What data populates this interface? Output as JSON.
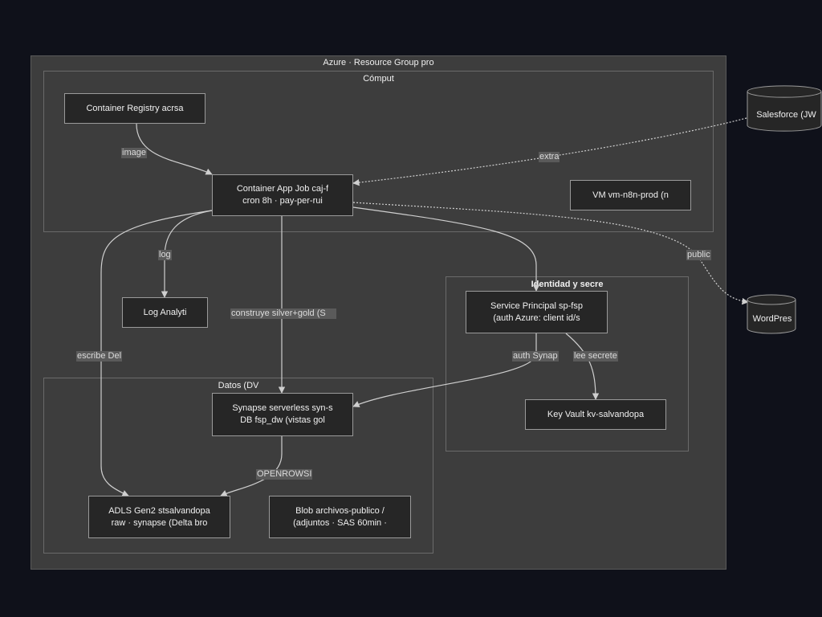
{
  "groups": {
    "resource_group": "Azure · Resource Group pro",
    "compute": "Cómput",
    "identity": "Identidad y secre",
    "data": "Datos (DV"
  },
  "nodes": {
    "acr": [
      "Container Registry acrsa"
    ],
    "caj": [
      "Container App Job caj-f",
      "cron 8h · pay-per-rui"
    ],
    "vm": [
      "VM vm-n8n-prod (n"
    ],
    "log": [
      "Log Analyti"
    ],
    "sp": [
      "Service Principal sp-fsp",
      "(auth Azure: client id/s"
    ],
    "kv": [
      "Key Vault kv-salvandopa"
    ],
    "syn": [
      "Synapse serverless syn-s",
      "DB fsp_dw (vistas gol"
    ],
    "adls": [
      "ADLS Gen2 stsalvandopa",
      "raw · synapse (Delta bro"
    ],
    "blob": [
      "Blob archivos-publico /",
      "(adjuntos · SAS 60min ·"
    ],
    "salesforce": "Salesforce (JW",
    "wordpress": "WordPres"
  },
  "edge_labels": {
    "image": "image",
    "extra": "extra",
    "public": "public",
    "log": "log",
    "construye": "construye silver+gold (S",
    "escribe": "escribe Del",
    "auth_synapse": "auth Synap",
    "lee_secretos": "lee secrete",
    "openrowset": "OPENROWSI"
  },
  "colors": {
    "background": "#0f111a",
    "group_fill": "#3d3d3d",
    "node_fill": "#262626",
    "edge": "#cfcfcf"
  }
}
